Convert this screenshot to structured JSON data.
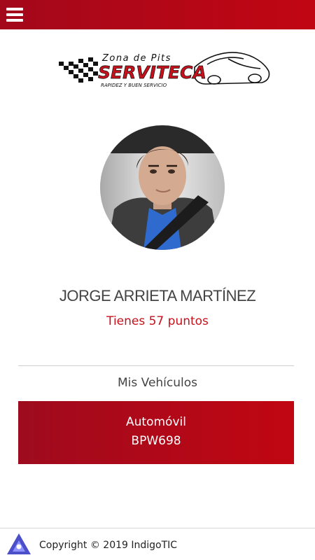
{
  "header": {
    "menu_icon": "hamburger-menu-icon",
    "background_color": "#b5081a"
  },
  "logo": {
    "line1": "Zona de Pits",
    "line2": "SERVITECA",
    "tagline": "RAPIDEZ Y BUEN SERVICIO"
  },
  "profile": {
    "name": "JORGE ARRIETA MARTÍNEZ",
    "points_text": "Tienes 57 puntos",
    "points_color": "#c4121d"
  },
  "vehicles": {
    "title": "Mis Vehículos",
    "items": [
      {
        "type": "Automóvil",
        "plate": "BPW698"
      }
    ]
  },
  "footer": {
    "icon": "indigotic-logo-icon",
    "copyright": "Copyright © 2019 IndigoTIC"
  }
}
